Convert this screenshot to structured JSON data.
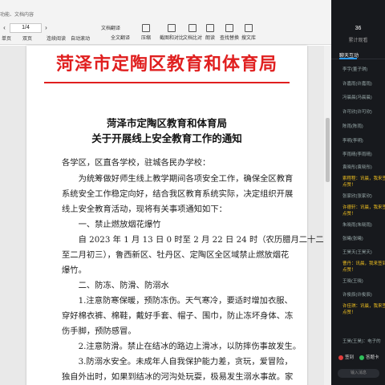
{
  "toolbar": {
    "search_hint": "功能、文档内容",
    "page_field": "1/4",
    "prev_symbol": "‹",
    "next_symbol": "›",
    "tools": [
      {
        "label": "放大"
      },
      {
        "label": "缩小"
      },
      {
        "label": "截图和对比"
      },
      {
        "label": "文档翻译"
      },
      {
        "label": "全文翻译"
      },
      {
        "label": "压缩"
      },
      {
        "label": "截图和对比"
      },
      {
        "label": "文档比对"
      },
      {
        "label": "朗读"
      },
      {
        "label": "查找替换"
      },
      {
        "label": "搜文库"
      }
    ],
    "row2": {
      "single": "单页",
      "double": "双页",
      "continuous": "连续阅读",
      "auto_scroll": "自动滚动",
      "background": "背景"
    }
  },
  "document": {
    "letterhead": "菏泽市定陶区教育和体育局",
    "title_line1": "菏泽市定陶区教育和体育局",
    "title_line2": "关于开展线上安全教育工作的通知",
    "paragraphs": [
      "各学区，区直各学校，驻城各民办学校：",
      "　　为统筹做好师生线上教学期间各项安全工作，确保全区教育",
      "系统安全工作稳定向好，结合我区教育系统实际，决定组织开展",
      "线上安全教育活动，现将有关事项通知如下：",
      "　　一、禁止燃放烟花爆竹",
      "　　自 2023 年 1 月 13 日 0 时至 2 月 22 日 24 时（农历腊月二十二",
      "至二月初三），鲁西新区、牡丹区、定陶区全区域禁止燃放烟花",
      "爆竹。",
      "　　二、防冻、防滑、防溺水",
      "　　1.注意防寒保暖，预防冻伤。天气寒冷，要适时增加衣服、",
      "穿好棉衣裤、棉鞋，戴好手套、帽子、围巾，防止冻坏身体、冻",
      "伤手脚，预防感冒。",
      "　　2.注意防滑。禁止在结冰的路边上滑冰，以防摔伤事故发生。",
      "　　3.防溺水安全。未成年人自我保护能力差，贪玩，爱冒险，",
      "独自外出时，如果到结冰的河沟处玩耍，极易发生溺水事故。家"
    ],
    "footer": "—1—"
  },
  "panel": {
    "stat_number": "36",
    "stat_label": "累计观看",
    "chat_tab": "聊天互动",
    "messages": [
      {
        "text": "李宇(董子琪)",
        "highlight": false
      },
      {
        "text": "许嘉雨(许嘉雨)",
        "highlight": false
      },
      {
        "text": "冯晨晨(冯晨晨)",
        "highlight": false
      },
      {
        "text": "许可欣(许可欣)",
        "highlight": false
      },
      {
        "text": "陈雨(陈雨)",
        "highlight": false
      },
      {
        "text": "李明(李明)",
        "highlight": false
      },
      {
        "text": "李雨晴(李雨晴)",
        "highlight": false
      },
      {
        "text": "袁晓彤(袁晓彤)",
        "highlight": false
      },
      {
        "text": "索程程：讯晨，我来签到",
        "highlight": true
      },
      {
        "text": "点赞！",
        "highlight": true
      },
      {
        "text": "张家欣(张家欣)",
        "highlight": false
      },
      {
        "text": "许德轩：讯晨，我来签到",
        "highlight": true
      },
      {
        "text": "点赞！",
        "highlight": true
      },
      {
        "text": "朱晓雨(朱晓雨)",
        "highlight": false
      },
      {
        "text": "张曦(张曦)",
        "highlight": false
      },
      {
        "text": "王昊天(王昊天)",
        "highlight": false
      },
      {
        "text": "曹丹：讯晨，我来签到",
        "highlight": true
      },
      {
        "text": "点赞！",
        "highlight": true
      },
      {
        "text": "王晓(王晓)",
        "highlight": false
      },
      {
        "text": "许俊辰(许俊辰)",
        "highlight": false
      },
      {
        "text": "许佳琪：讯晨，我来签到",
        "highlight": true
      },
      {
        "text": "点赞！",
        "highlight": true
      },
      {
        "text": "王昊(王昊)：电子的",
        "highlight": false
      }
    ],
    "btn_a": "签到",
    "btn_b": "答题卡",
    "input_placeholder": "输入消息"
  }
}
